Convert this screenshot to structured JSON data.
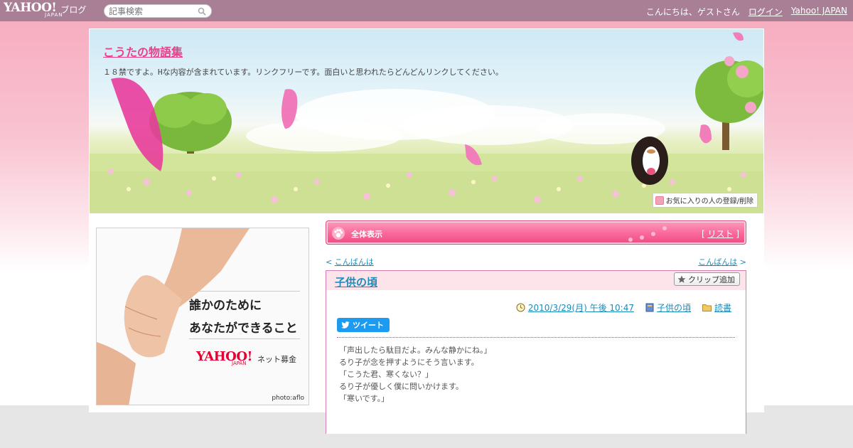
{
  "masthead": {
    "logo": "YAHOO!",
    "logo_sub": "JAPAN",
    "logo_blog": "ブログ",
    "search_placeholder": "記事検索",
    "greeting": "こんにちは、ゲストさん",
    "login": "ログイン",
    "yahoo_japan": "Yahoo! JAPAN"
  },
  "blog": {
    "title": "こうたの物語集",
    "description": "１８禁ですよ。Hな内容が含まれています。リンクフリーです。面白いと思われたらどんどんリンクしてください。",
    "favorite_button": "お気に入りの人の登録/削除"
  },
  "ad": {
    "line1": "誰かのために",
    "line2": "あなたができること",
    "brand": "YAHOO!",
    "brand_sub": "JAPAN",
    "donate": "ネット募金",
    "credit": "photo:aflo"
  },
  "section": {
    "title": "全体表示",
    "list_label": "リスト",
    "list_open": "[",
    "list_close": "]"
  },
  "pager": {
    "prev_arrow": "<",
    "prev": "こんばんは",
    "next": "こんばんは",
    "next_arrow": ">"
  },
  "article": {
    "title": "子供の頃",
    "clip_label": "クリップ追加",
    "date": "2010/3/29(月) 午後 10:47",
    "category": "子供の頃",
    "theme": "読書",
    "tweet_label": "ツイート",
    "lines": [
      "「声出したら駄目だよ。みんな静かにね。」",
      "るり子が念を押すようにそう言います。",
      "「こうた君、寒くない？」",
      "るり子が優しく僕に問いかけます。",
      "「寒いです。」"
    ]
  },
  "colors": {
    "masthead": "#a97f95",
    "accent_pink": "#e8418b",
    "link_blue": "#1a8cbc",
    "section_bar": "#f9689b"
  }
}
